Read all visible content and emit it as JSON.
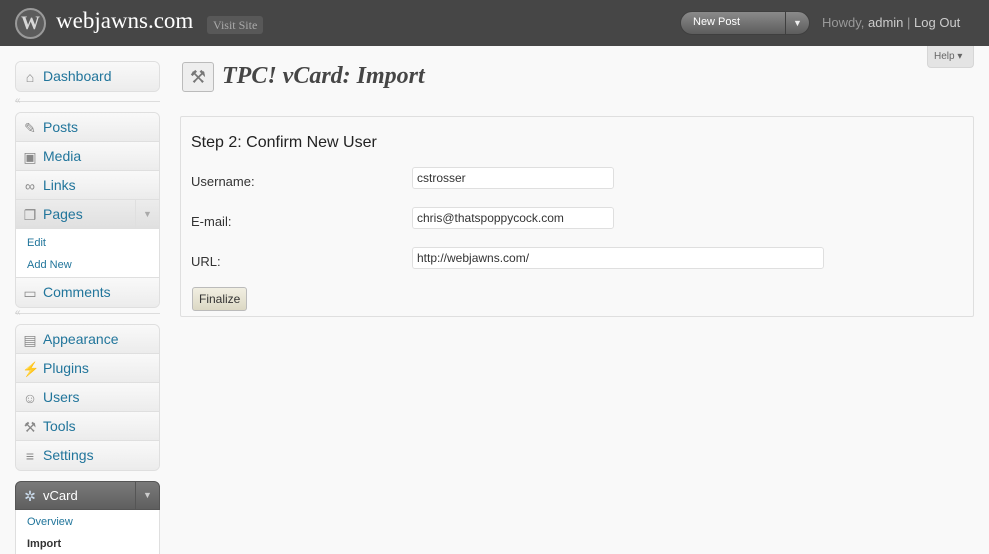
{
  "header": {
    "site_title": "webjawns.com",
    "visit_site_label": "Visit Site",
    "new_post_label": "New Post",
    "howdy_text": "Howdy, ",
    "username": "admin",
    "separator": " | ",
    "logout_label": "Log Out"
  },
  "help_label": "Help",
  "sidebar": {
    "dashboard": "Dashboard",
    "posts": "Posts",
    "media": "Media",
    "links": "Links",
    "pages": "Pages",
    "pages_sub": [
      "Edit",
      "Add New"
    ],
    "comments": "Comments",
    "appearance": "Appearance",
    "plugins": "Plugins",
    "users": "Users",
    "tools": "Tools",
    "settings": "Settings",
    "vcard": "vCard",
    "vcard_sub": [
      "Overview",
      "Import"
    ]
  },
  "page": {
    "title": "TPC! vCard: Import",
    "step_title": "Step 2: Confirm New User",
    "username_label": "Username:",
    "username_value": "cstrosser",
    "email_label": "E-mail:",
    "email_value": "chris@thatspoppycock.com",
    "url_label": "URL:",
    "url_value": "http://webjawns.com/",
    "finalize_label": "Finalize"
  },
  "icons": {
    "wordpress_logo": "wordpress-logo-icon",
    "dashboard": "house-icon",
    "posts": "pushpin-icon",
    "media": "camera-icon",
    "links": "chain-link-icon",
    "pages": "pages-icon",
    "comments": "speech-bubble-icon",
    "appearance": "layout-icon",
    "plugins": "plug-icon",
    "users": "users-icon",
    "tools": "tools-icon",
    "settings": "sliders-icon",
    "vcard": "gear-icon"
  },
  "colors": {
    "header_bg": "#464646",
    "link": "#21759b",
    "page_bg": "#f9f9f9"
  }
}
